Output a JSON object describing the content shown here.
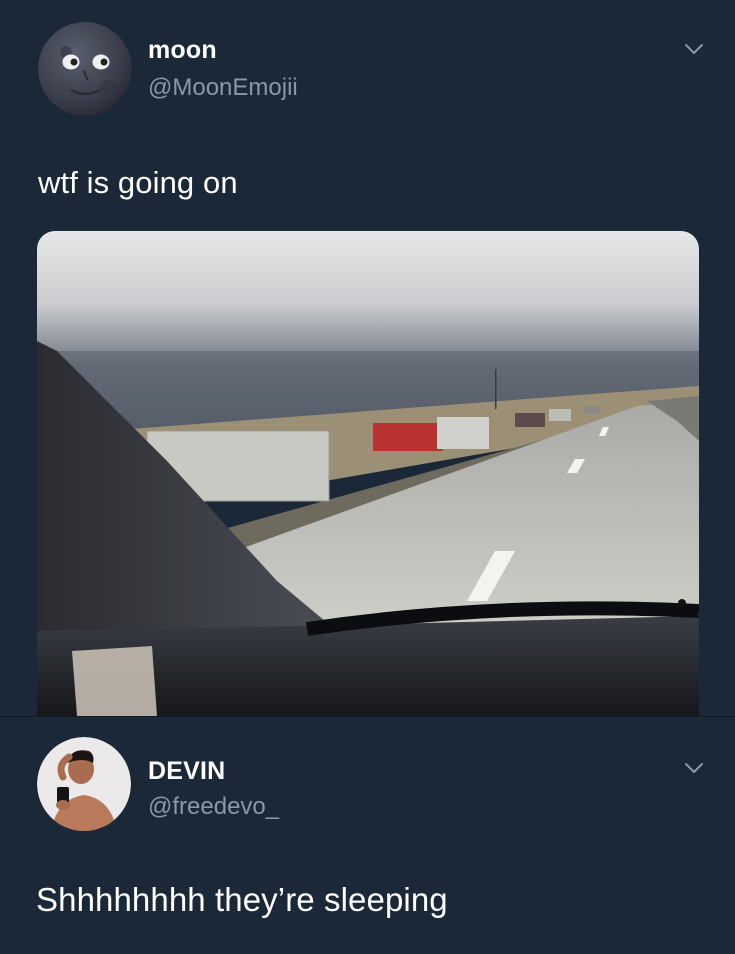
{
  "tweets": [
    {
      "display_name": "moon",
      "handle": "@MoonEmojii",
      "avatar_icon": "moon-face-icon",
      "text": "wtf is going on",
      "media": "photo-highway-overturned-trucks"
    },
    {
      "display_name": "DEVIN",
      "handle": "@freedevo_",
      "avatar_icon": "person-photo-avatar",
      "text": "Shhhhhhhh they’re sleeping"
    }
  ],
  "colors": {
    "background": "#1b2838",
    "handle": "#8899a6",
    "text": "#ffffff"
  },
  "icons": {
    "menu": "chevron-down-icon"
  }
}
